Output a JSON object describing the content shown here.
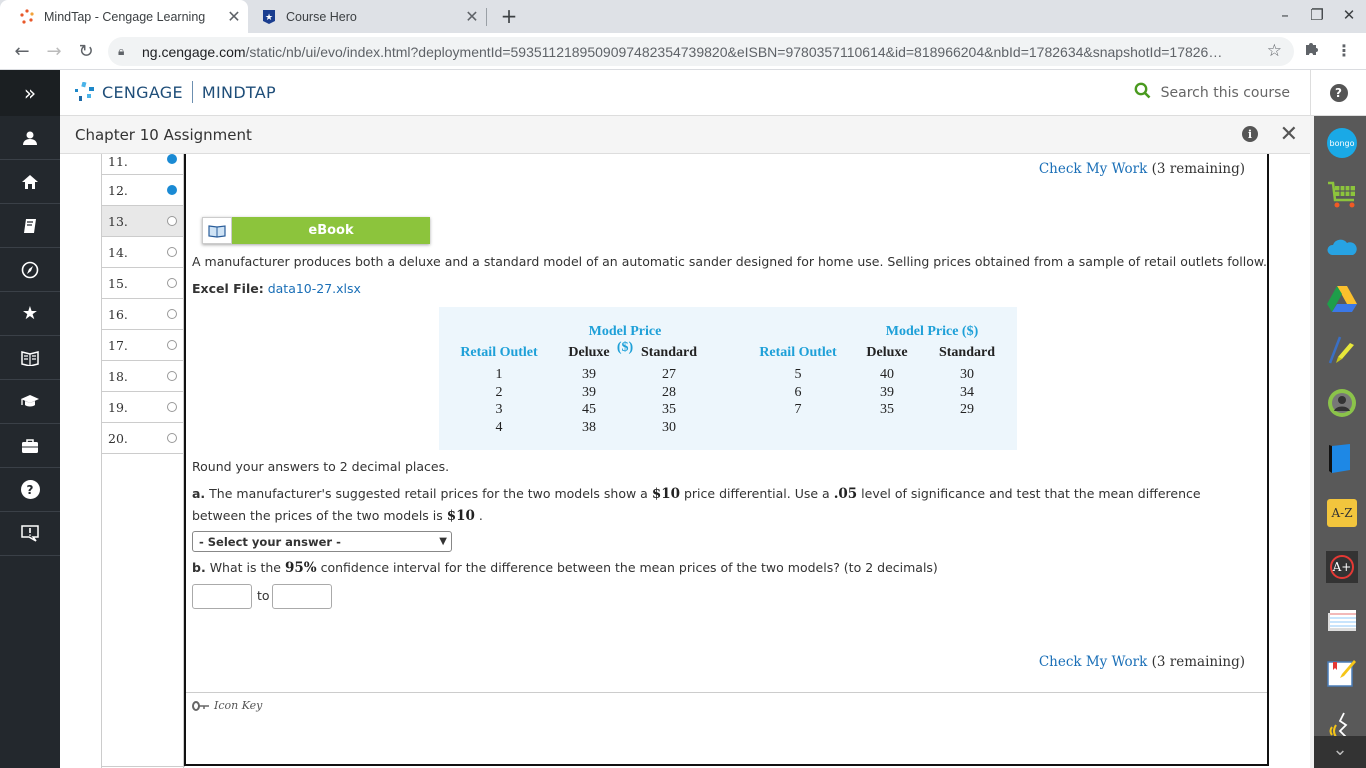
{
  "browser": {
    "tabs": [
      {
        "title": "MindTap - Cengage Learning",
        "active": true,
        "icon": "cengage-favicon"
      },
      {
        "title": "Course Hero",
        "active": false,
        "icon": "coursehero-favicon"
      }
    ],
    "url_host": "ng.cengage.com",
    "url_path": "/static/nb/ui/evo/index.html?deploymentId=5935112189509097482354739820&eISBN=9780357110614&id=818966204&nbId=1782634&snapshotId=17826…"
  },
  "header": {
    "brand_left": "CENGAGE",
    "brand_right": "MINDTAP",
    "search_placeholder": "Search this course",
    "help_label": "?"
  },
  "subheader": {
    "title": "Chapter 10 Assignment"
  },
  "left_nav": {
    "items": [
      "expand",
      "account",
      "home",
      "notebook",
      "compass",
      "favorites",
      "ebook",
      "grades",
      "briefcase",
      "help",
      "feedback"
    ]
  },
  "question_list": {
    "items": [
      {
        "num": "11.",
        "status": "answered"
      },
      {
        "num": "12.",
        "status": "answered"
      },
      {
        "num": "13.",
        "status": "current"
      },
      {
        "num": "14.",
        "status": "unanswered"
      },
      {
        "num": "15.",
        "status": "unanswered"
      },
      {
        "num": "16.",
        "status": "unanswered"
      },
      {
        "num": "17.",
        "status": "unanswered"
      },
      {
        "num": "18.",
        "status": "unanswered"
      },
      {
        "num": "19.",
        "status": "unanswered"
      },
      {
        "num": "20.",
        "status": "unanswered"
      }
    ]
  },
  "content": {
    "check_my_work": {
      "link": "Check My Work",
      "remaining": "(3 remaining)"
    },
    "ebook_label": "eBook",
    "intro": "A manufacturer produces both a deluxe and a standard model of an automatic sander designed for home use. Selling prices obtained from a sample of retail outlets follow.",
    "excel_label": "Excel File:",
    "excel_file": "data10-27.xlsx",
    "table": {
      "group_header": "Model Price ($)",
      "col_outlet": "Retail Outlet",
      "col_deluxe": "Deluxe",
      "col_standard": "Standard",
      "left_rows": [
        {
          "outlet": "1",
          "deluxe": "39",
          "standard": "27"
        },
        {
          "outlet": "2",
          "deluxe": "39",
          "standard": "28"
        },
        {
          "outlet": "3",
          "deluxe": "45",
          "standard": "35"
        },
        {
          "outlet": "4",
          "deluxe": "38",
          "standard": "30"
        }
      ],
      "right_rows": [
        {
          "outlet": "5",
          "deluxe": "40",
          "standard": "30"
        },
        {
          "outlet": "6",
          "deluxe": "39",
          "standard": "34"
        },
        {
          "outlet": "7",
          "deluxe": "35",
          "standard": "29"
        }
      ]
    },
    "round_note": "Round your answers to 2 decimal places.",
    "part_a": {
      "label": "a.",
      "text1": "The manufacturer's suggested retail prices for the two models show a",
      "val1": "$10",
      "text2": "price differential. Use a",
      "val2": ".05",
      "text3": "level of significance and test that the mean difference between the prices of the two models is",
      "val3": "$10",
      "text4": ".",
      "select_value": "- Select your answer -"
    },
    "part_b": {
      "label": "b.",
      "text1": "What is the",
      "val1": "95%",
      "text2": "confidence interval for the difference between the mean prices of the two models? (to 2 decimals)",
      "lower_value": "",
      "to_label": "to",
      "upper_value": ""
    },
    "icon_key": "Icon Key"
  },
  "tools_rail": {
    "items": [
      "bongo",
      "cart",
      "onedrive",
      "google-drive",
      "highlighter",
      "profile",
      "book",
      "dictionary",
      "aplus",
      "flashcards",
      "notes",
      "readspeaker"
    ]
  }
}
